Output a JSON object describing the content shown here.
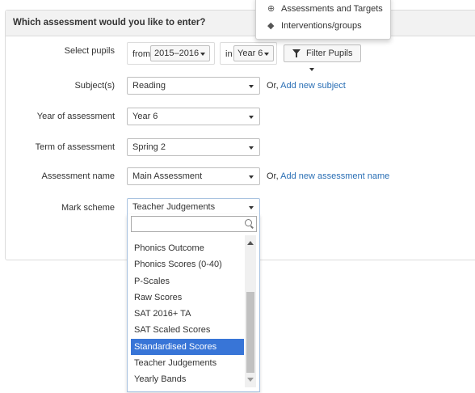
{
  "menu": {
    "items": [
      {
        "icon": "plus-circle-icon",
        "label": "Assessments and Targets"
      },
      {
        "icon": "tag-icon",
        "label": "Interventions/groups"
      }
    ]
  },
  "panel": {
    "title": "Which assessment would you like to enter?"
  },
  "form": {
    "select_pupils": {
      "label": "Select pupils",
      "from_label": "from",
      "year_range": "2015–2016",
      "in_label": "in",
      "year_group": "Year 6",
      "filter_button": "Filter Pupils"
    },
    "subject": {
      "label": "Subject(s)",
      "value": "Reading",
      "or": "Or,",
      "link": "Add new subject"
    },
    "year_of_assessment": {
      "label": "Year of assessment",
      "value": "Year 6"
    },
    "term": {
      "label": "Term of assessment",
      "value": "Spring 2"
    },
    "assessment_name": {
      "label": "Assessment name",
      "value": "Main Assessment",
      "or": "Or,",
      "link": "Add new assessment name"
    },
    "mark_scheme": {
      "label": "Mark scheme",
      "value": "Teacher Judgements",
      "search_placeholder": "",
      "options": [
        "Phonics Outcome",
        "Phonics Scores (0-40)",
        "P-Scales",
        "Raw Scores",
        "SAT 2016+ TA",
        "SAT Scaled Scores",
        "Standardised Scores",
        "Teacher Judgements",
        "Yearly Bands"
      ],
      "highlighted": "Standardised Scores"
    }
  }
}
